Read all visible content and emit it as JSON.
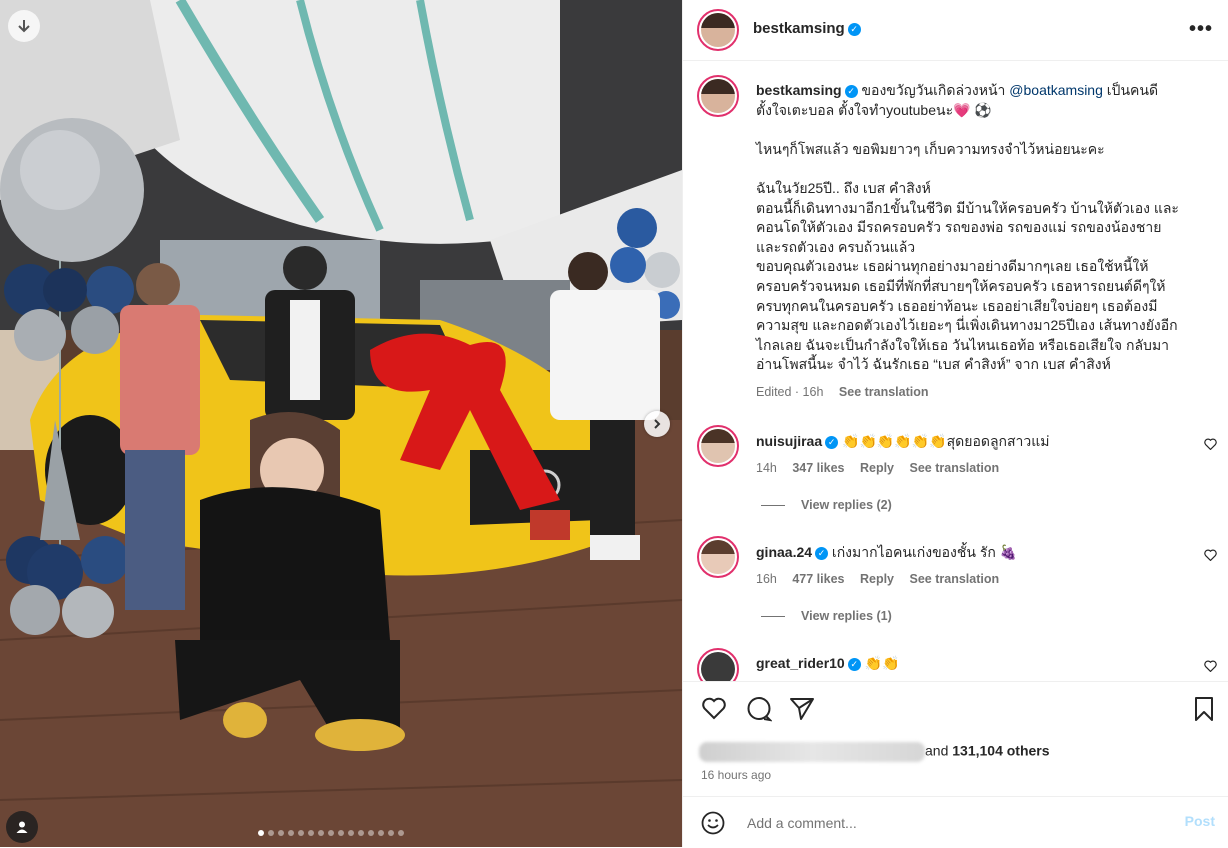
{
  "post": {
    "username": "bestkamsing",
    "more_icon": "more-horizontal-icon",
    "image_dots_count": 15,
    "active_dot": 0
  },
  "caption": {
    "username": "bestkamsing",
    "intro": "ของขวัญวันเกิดล่วงหน้า",
    "mention": "@boatkamsing",
    "line1_tail": "เป็นคนดี",
    "line2": "ตั้งใจเตะบอล ตั้งใจทำyoutubeนะ💗 ⚽",
    "para2": "ไหนๆก็โพสแล้ว ขอพิมยาวๆ เก็บความทรงจำไว้หน่อยนะคะ",
    "para3_l1": "ฉันในวัย25ปี.. ถึง เบส คำสิงห์",
    "para3_l2": "ตอนนี้ก็เดินทางมาอีก1ขั้นในชีวิต มีบ้านให้ครอบครัว บ้านให้ตัวเอง และ",
    "para3_l3": "คอนโดให้ตัวเอง มีรถครอบครัว รถของพ่อ รถของแม่ รถของน้องชาย",
    "para3_l4": "และรถตัวเอง ครบถ้วนแล้ว",
    "para3_l5": "ขอบคุณตัวเองนะ เธอผ่านทุกอย่างมาอย่างดีมากๆเลย เธอใช้หนี้ให้",
    "para3_l6": "ครอบครัวจนหมด เธอมีที่พักที่สบายๆให้ครอบครัว เธอหารถยนต์ดีๆให้",
    "para3_l7": "ครบทุกคนในครอบครัว เธออย่าท้อนะ เธออย่าเสียใจบ่อยๆ เธอต้องมี",
    "para3_l8": "ความสุข และกอดตัวเองไว้เยอะๆ นี่เพิ่งเดินทางมา25ปีเอง เส้นทางยังอีก",
    "para3_l9": "ไกลเลย ฉันจะเป็นกำลังใจให้เธอ วันไหนเธอท้อ หรือเธอเสียใจ กลับมา",
    "para3_l10": "อ่านโพสนี้นะ จำไว้ ฉันรักเธอ “เบส คำสิงห์” จาก เบส คำสิงห์",
    "edited": "Edited · 16h",
    "see_translation": "See translation"
  },
  "comments": [
    {
      "username": "nuisujiraa",
      "text": "👏👏👏👏👏👏สุดยอดลูกสาวแม่",
      "time": "14h",
      "likes": "347 likes",
      "reply": "Reply",
      "see_translation": "See translation",
      "view_replies": "View replies (2)"
    },
    {
      "username": "ginaa.24",
      "text": "เก่งมากไอคนเก่งของชั้น รัก 🍇",
      "time": "16h",
      "likes": "477 likes",
      "reply": "Reply",
      "see_translation": "See translation",
      "view_replies": "View replies (1)"
    },
    {
      "username": "great_rider10",
      "text": "👏👏"
    }
  ],
  "actions": {
    "like_icon": "heart-icon",
    "comment_icon": "comment-icon",
    "share_icon": "share-icon",
    "save_icon": "bookmark-icon",
    "likes_and": "and",
    "likes_others": "131,104 others",
    "time_ago": "16 hours ago"
  },
  "comment_bar": {
    "placeholder": "Add a comment...",
    "post_label": "Post"
  },
  "colors": {
    "verified": "#0095f6",
    "post_disabled": "#b2dffc",
    "story_ring": "#e1306c",
    "mention": "#00376b"
  }
}
